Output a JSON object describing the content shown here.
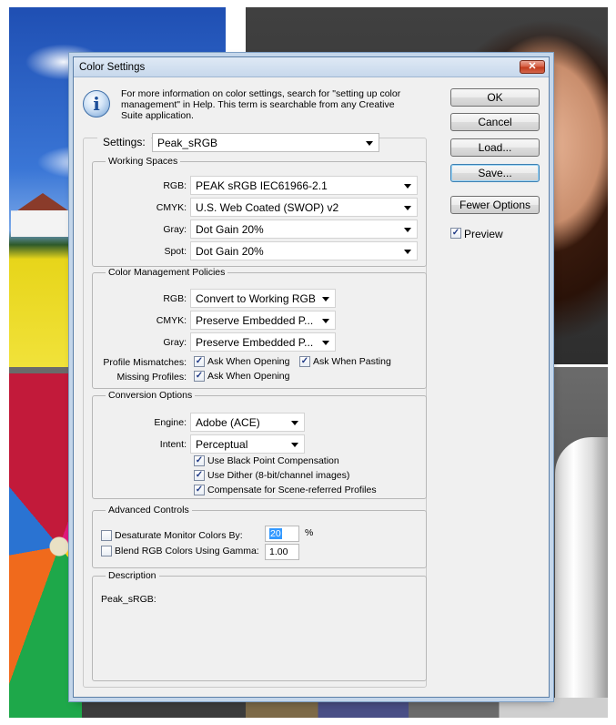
{
  "dialog": {
    "title": "Color Settings",
    "close_glyph": "✕",
    "info_text": "For more information on color settings, search for \"setting up color management\" in Help. This term is searchable from any Creative Suite application."
  },
  "settings": {
    "label": "Settings:",
    "value": "Peak_sRGB"
  },
  "working_spaces": {
    "title": "Working Spaces",
    "rows": [
      {
        "label": "RGB:",
        "value": "PEAK sRGB IEC61966-2.1"
      },
      {
        "label": "CMYK:",
        "value": "U.S. Web Coated (SWOP) v2"
      },
      {
        "label": "Gray:",
        "value": "Dot Gain 20%"
      },
      {
        "label": "Spot:",
        "value": "Dot Gain 20%"
      }
    ]
  },
  "policies": {
    "title": "Color Management Policies",
    "rows": [
      {
        "label": "RGB:",
        "value": "Convert to Working RGB"
      },
      {
        "label": "CMYK:",
        "value": "Preserve Embedded P..."
      },
      {
        "label": "Gray:",
        "value": "Preserve Embedded P..."
      }
    ],
    "profile_mismatches_label": "Profile Mismatches:",
    "ask_when_opening": "Ask When Opening",
    "ask_when_pasting": "Ask When Pasting",
    "missing_profiles_label": "Missing Profiles:",
    "missing_ask_when_opening": "Ask When Opening"
  },
  "conversion": {
    "title": "Conversion Options",
    "engine_label": "Engine:",
    "engine_value": "Adobe (ACE)",
    "intent_label": "Intent:",
    "intent_value": "Perceptual",
    "black_point": "Use Black Point Compensation",
    "dither": "Use Dither (8-bit/channel images)",
    "scene_referred": "Compensate for Scene-referred Profiles"
  },
  "advanced": {
    "title": "Advanced Controls",
    "desaturate_label": "Desaturate Monitor Colors By:",
    "desaturate_value": "20",
    "percent": "%",
    "blend_label": "Blend RGB Colors Using Gamma:",
    "blend_value": "1.00"
  },
  "description": {
    "title": "Description",
    "text": "Peak_sRGB:"
  },
  "buttons": {
    "ok": "OK",
    "cancel": "Cancel",
    "load": "Load...",
    "save": "Save...",
    "fewer_options": "Fewer Options",
    "preview": "Preview"
  },
  "check_glyph": "✓",
  "colors": {
    "selection": "#3399ff",
    "title_bar": "#c7d8ec",
    "close_button": "#c1391a",
    "dialog_bg": "#f0f0f0"
  }
}
